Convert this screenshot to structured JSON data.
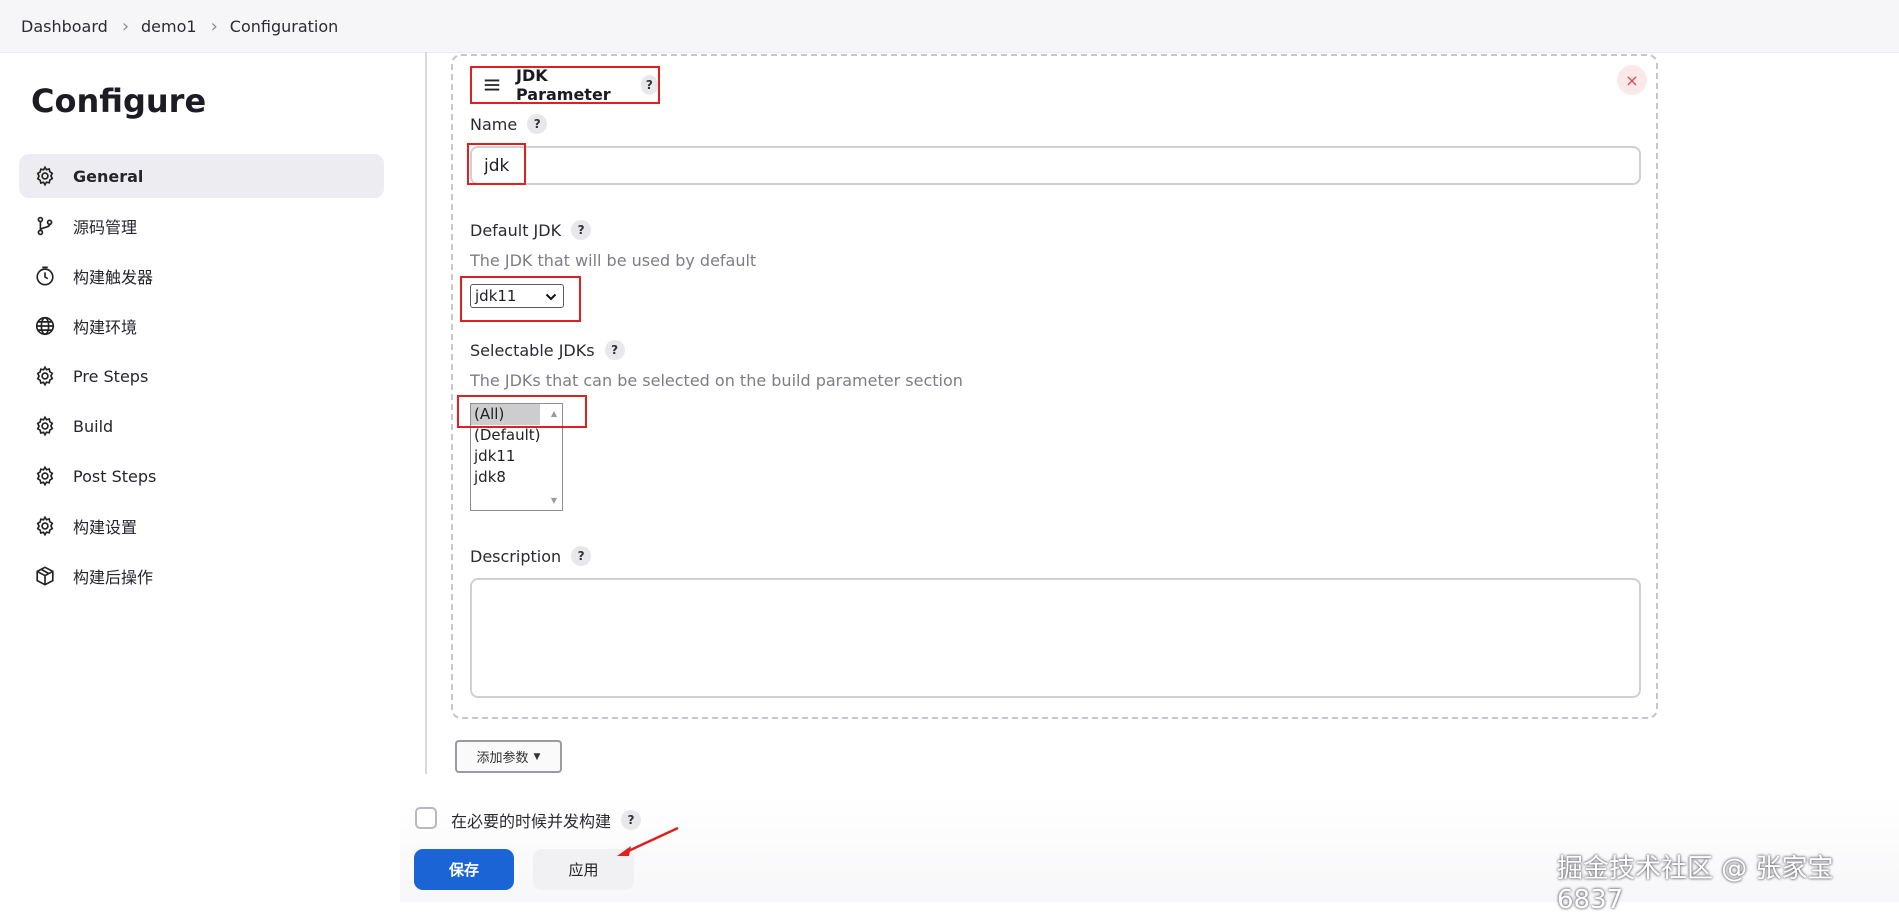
{
  "breadcrumb": {
    "items": [
      "Dashboard",
      "demo1",
      "Configuration"
    ]
  },
  "sidebar": {
    "title": "Configure",
    "items": [
      {
        "label": "General",
        "icon": "gear-icon",
        "active": true
      },
      {
        "label": "源码管理",
        "icon": "branch-icon",
        "active": false
      },
      {
        "label": "构建触发器",
        "icon": "clock-icon",
        "active": false
      },
      {
        "label": "构建环境",
        "icon": "globe-icon",
        "active": false
      },
      {
        "label": "Pre Steps",
        "icon": "gear-icon",
        "active": false
      },
      {
        "label": "Build",
        "icon": "gear-icon",
        "active": false
      },
      {
        "label": "Post Steps",
        "icon": "gear-icon",
        "active": false
      },
      {
        "label": "构建设置",
        "icon": "gear-icon",
        "active": false
      },
      {
        "label": "构建后操作",
        "icon": "package-icon",
        "active": false
      }
    ]
  },
  "parameter": {
    "title": "JDK Parameter",
    "help": "?",
    "close": "×",
    "name": {
      "label": "Name",
      "help": "?",
      "value": "jdk"
    },
    "default_jdk": {
      "label": "Default JDK",
      "help": "?",
      "description": "The JDK that will be used by default",
      "selected": "jdk11"
    },
    "selectable_jdks": {
      "label": "Selectable JDKs",
      "help": "?",
      "description": "The JDKs that can be selected on the build parameter section",
      "options": [
        "(All)",
        "(Default)",
        "jdk11",
        "jdk8"
      ],
      "selected": "(All)"
    },
    "description": {
      "label": "Description",
      "help": "?",
      "value": ""
    }
  },
  "add_parameter": {
    "label": "添加参数"
  },
  "concurrent_build": {
    "label": "在必要的时候并发构建",
    "help": "?",
    "checked": false
  },
  "actions": {
    "save": "保存",
    "apply": "应用"
  },
  "credit": "掘金技术社区 @ 张家宝6837",
  "colors": {
    "accent": "#1a64d6",
    "highlight_box": "#e02020",
    "sidebar_active_bg": "#ededf1"
  }
}
